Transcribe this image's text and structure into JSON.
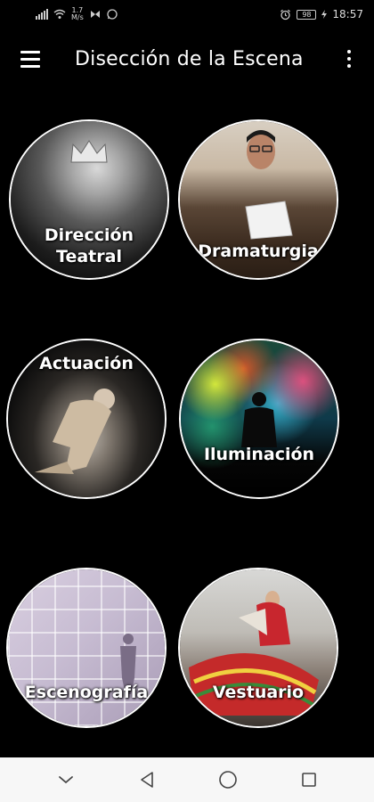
{
  "status_bar": {
    "network_speed_value": "1.7",
    "network_speed_unit": "M/s",
    "battery_level": "98",
    "time": "18:57"
  },
  "app_bar": {
    "title": "Disección de la Escena"
  },
  "categories": [
    {
      "label": "Dirección\nTeatral"
    },
    {
      "label": "Dramaturgia"
    },
    {
      "label": "Actuación"
    },
    {
      "label": "Iluminación"
    },
    {
      "label": "Escenografía"
    },
    {
      "label": "Vestuario"
    }
  ],
  "icons": {
    "menu": "hamburger-menu-icon",
    "more": "more-vert-icon",
    "nav_down": "chevron-down-icon",
    "nav_back": "back-triangle-icon",
    "nav_home": "home-circle-icon",
    "nav_recents": "recents-square-icon"
  },
  "colors": {
    "background": "#000000",
    "text": "#ffffff",
    "navbar": "#f7f7f7"
  }
}
